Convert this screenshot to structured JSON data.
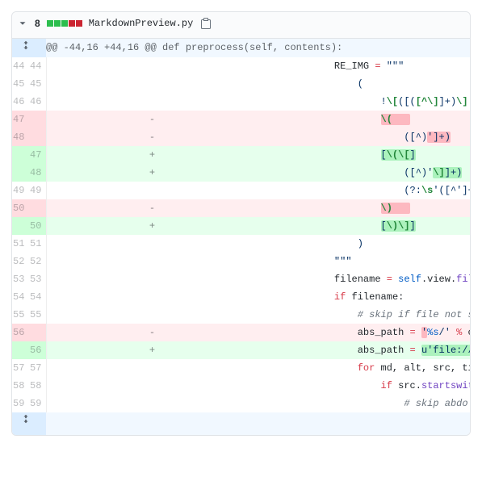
{
  "header": {
    "change_count": "8",
    "diffstat": [
      "a",
      "a",
      "a",
      "d",
      "d"
    ],
    "filename": "MarkdownPreview.py"
  },
  "hunk_header": "@@ -44,16 +44,16 @@ def preprocess(self, contents):",
  "rows": [
    {
      "t": "ctx",
      "ol": "44",
      "nl": "44",
      "html": "            RE_IMG <span class=\"pl-k\">=</span> <span class=\"pl-s\">\"\"\"</span>"
    },
    {
      "t": "ctx",
      "ol": "45",
      "nl": "45",
      "html": "<span class=\"pl-s\">                (</span>"
    },
    {
      "t": "ctx",
      "ol": "46",
      "nl": "46",
      "html": "<span class=\"pl-s\">                    !<span class=\"pl-cce\">\\[</span>([(<span class=\"pl-cce\">[^\\]</span>]+)<span class=\"pl-cce\">\\]</span>             <span class=\"pl-c\"># alternative text</span></span>"
    },
    {
      "t": "del",
      "ol": "47",
      "nl": "",
      "html": "<span class=\"pl-s\">                    <span class=\"x\"><span class=\"pl-cce\">\\(</span>   </span>                      <span class=\"pl-c\"># source start</span></span>"
    },
    {
      "t": "del",
      "ol": "48",
      "nl": "",
      "html": "<span class=\"pl-s\">                        ([^)<span class=\"x\">']+)</span>               <span class=\"pl-c\"># image path</span></span>"
    },
    {
      "t": "add",
      "ol": "",
      "nl": "47",
      "html": "<span class=\"pl-s\">                    <span class=\"xi\">[<span class=\"pl-cce\">\\(\\[</span>]</span>                    <span class=\"pl-c\"># source start</span></span>"
    },
    {
      "t": "add",
      "ol": "",
      "nl": "48",
      "html": "<span class=\"pl-s\">                        ([^)'<span class=\"xi\"><span class=\"pl-cce\">\\]</span>]+)</span>             <span class=\"pl-c\"># image path</span></span>"
    },
    {
      "t": "ctx",
      "ol": "49",
      "nl": "49",
      "html": "<span class=\"pl-s\">                        (?:<span class=\"pl-cce\">\\s</span>'([^']+)')?        <span class=\"pl-c\"># optional title</span></span>"
    },
    {
      "t": "del",
      "ol": "50",
      "nl": "",
      "html": "<span class=\"pl-s\">                    <span class=\"x\"><span class=\"pl-cce\">\\)</span>   </span>                      <span class=\"pl-c\"># source end</span></span>"
    },
    {
      "t": "add",
      "ol": "",
      "nl": "50",
      "html": "<span class=\"pl-s\">                    <span class=\"xi\">[<span class=\"pl-cce\">\\)\\]</span>]</span>                    <span class=\"pl-c\"># source end</span></span>"
    },
    {
      "t": "ctx",
      "ol": "51",
      "nl": "51",
      "html": "<span class=\"pl-s\">                )</span>"
    },
    {
      "t": "ctx",
      "ol": "52",
      "nl": "52",
      "html": "<span class=\"pl-s\">            \"\"\"</span>"
    },
    {
      "t": "ctx",
      "ol": "53",
      "nl": "53",
      "html": "            filename <span class=\"pl-k\">=</span> <span class=\"pl-c1\">self</span>.view.<span class=\"pl-en\">file_name</span>()"
    },
    {
      "t": "ctx",
      "ol": "54",
      "nl": "54",
      "html": "            <span class=\"pl-k\">if</span> filename:"
    },
    {
      "t": "ctx",
      "ol": "55",
      "nl": "55",
      "html": "                <span class=\"pl-c\"># skip if file not saved</span>"
    },
    {
      "t": "del",
      "ol": "56",
      "nl": "",
      "html": "                abs_path <span class=\"pl-k\">=</span> <span class=\"x\"><span class=\"pl-s\">'</span></span><span class=\"pl-s\"><span class=\"pl-c1\">%s</span>/'</span> <span class=\"pl-k\">%</span> os.path.dirname(filename)"
    },
    {
      "t": "add",
      "ol": "",
      "nl": "56",
      "html": "                abs_path <span class=\"pl-k\">=</span> <span class=\"xi\"><span class=\"pl-s\">u'file://</span></span><span class=\"pl-s\"><span class=\"pl-c1\">%s</span>/'</span> <span class=\"pl-k\">%</span> os.path.dirname(fi"
    },
    {
      "t": "ctx",
      "ol": "57",
      "nl": "57",
      "html": "                <span class=\"pl-k\">for</span> md, alt, src, title <span class=\"pl-k\">in</span> re.findall(RE_IMG,"
    },
    {
      "t": "ctx",
      "ol": "58",
      "nl": "58",
      "html": "                    <span class=\"pl-k\">if</span> src.<span class=\"pl-en\">startswith</span>((<span class=\"pl-s\">'http'</span>, <span class=\"pl-s\">'/'</span>)):"
    },
    {
      "t": "ctx",
      "ol": "59",
      "nl": "59",
      "html": "                        <span class=\"pl-c\"># skip abdolute paths</span>"
    }
  ]
}
